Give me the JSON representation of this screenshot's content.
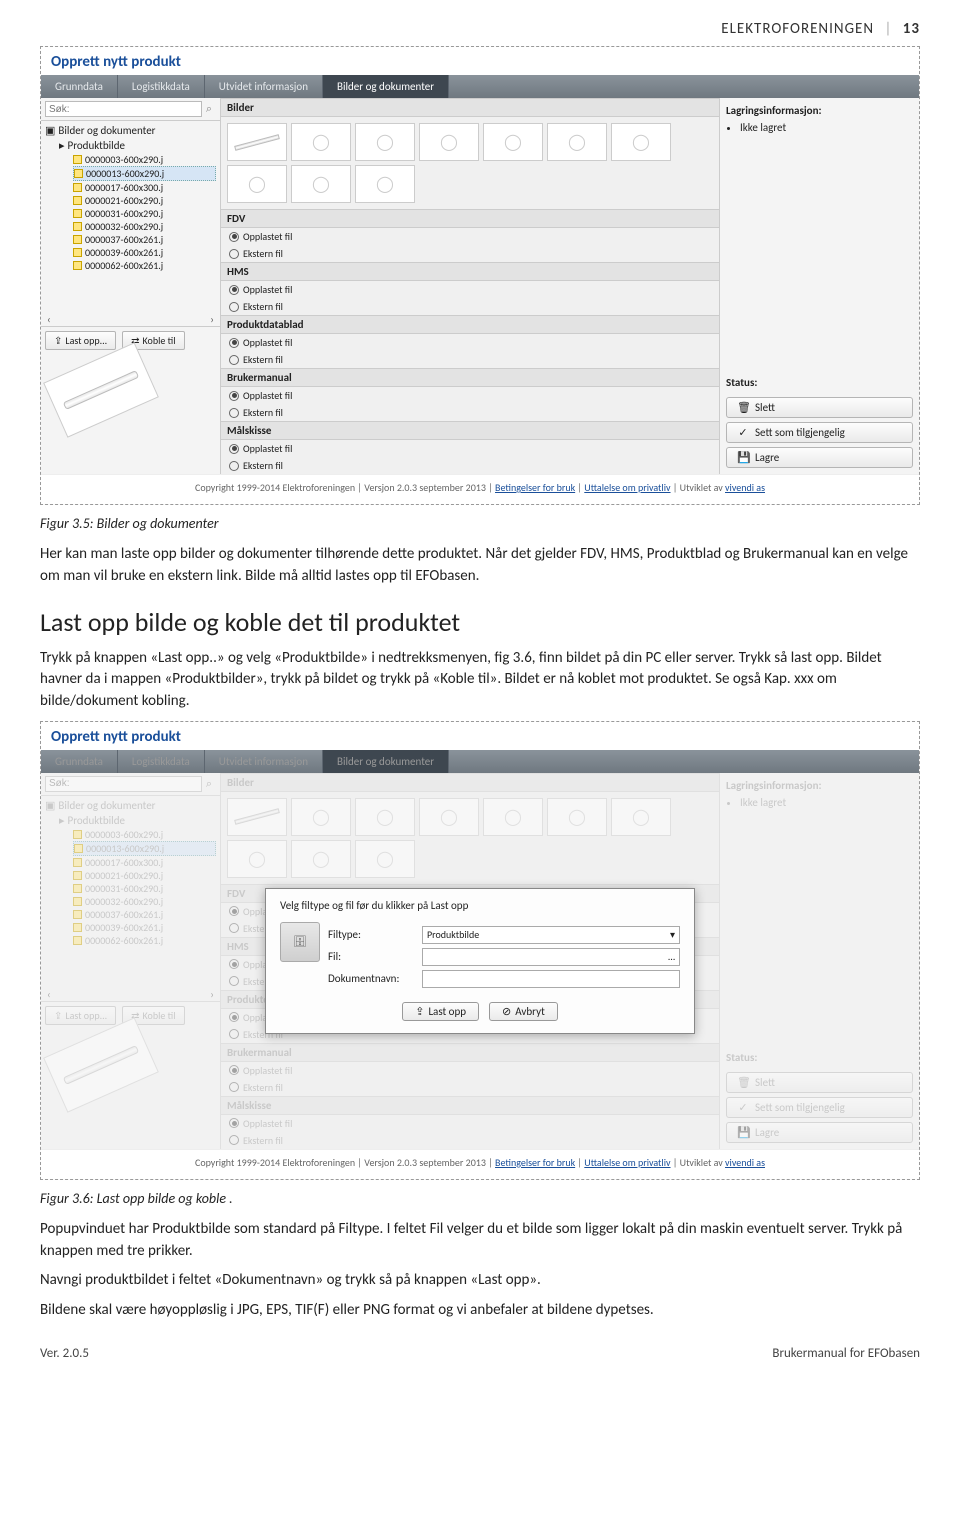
{
  "header": {
    "title": "ELEKTROFORENINGEN",
    "page": "13"
  },
  "app": {
    "title": "Opprett nytt produkt",
    "tabs": [
      "Grunndata",
      "Logistikkdata",
      "Utvidet informasjon",
      "Bilder og dokumenter"
    ],
    "search_placeholder": "Søk:",
    "tree_root": "Bilder og dokumenter",
    "tree_folder": "Produktbilde",
    "files": [
      "0000003-600x290.j",
      "0000013-600x290.j",
      "0000017-600x300.j",
      "0000021-600x290.j",
      "0000031-600x290.j",
      "0000032-600x290.j",
      "0000037-600x261.j",
      "0000039-600x261.j",
      "0000062-600x261.j"
    ],
    "btn_upload": "Last opp...",
    "btn_link": "Koble til",
    "sections": {
      "bilder": "Bilder",
      "fdv": "FDV",
      "hms": "HMS",
      "datablad": "Produktdatablad",
      "manual": "Brukermanual",
      "maalskisse": "Målskisse"
    },
    "radio_uploaded": "Opplastet fil",
    "radio_external": "Ekstern fil",
    "right": {
      "storage_label": "Lagringsinformasjon:",
      "storage_item": "Ikke lagret",
      "status_label": "Status:",
      "btn_delete": "Slett",
      "btn_avail": "Sett som tilgjengelig",
      "btn_save": "Lagre"
    },
    "copyright": {
      "text1": "Copyright 1999-2014 Elektroforeningen | Versjon 2.0.3 september 2013 | ",
      "link1": "Betingelser for bruk",
      "sep": " | ",
      "link2": "Uttalelse om privatliv",
      "text2": " | Utviklet av ",
      "link3": "vivendi as"
    }
  },
  "dialog": {
    "title": "Velg filtype og fil før du klikker på Last opp",
    "lbl_filtype": "Filtype:",
    "val_filtype": "Produktbilde",
    "lbl_fil": "Fil:",
    "lbl_doknavn": "Dokumentnavn:",
    "btn_upload": "Last opp",
    "btn_cancel": "Avbryt"
  },
  "captions": {
    "fig35": "Figur 3.5: Bilder og dokumenter",
    "fig36": "Figur 3.6: Last opp bilde og koble ."
  },
  "text": {
    "p1": "Her kan man laste opp bilder og dokumenter tilhørende dette produktet. Når det gjelder FDV, HMS, Produktblad og Brukermanual kan en velge om man vil bruke en ekstern link. Bilde må alltid lastes opp til EFObasen.",
    "h2": "Last opp bilde og koble det til produktet",
    "p2": "Trykk på knappen «Last opp..» og velg «Produktbilde» i nedtrekksmenyen, fig 3.6, finn bildet på din PC eller server. Trykk så last opp. Bildet havner da i mappen «Produktbilder», trykk på bildet og trykk på «Koble til». Bildet er nå koblet mot produktet.  Se også Kap. xxx om bilde/dokument kobling.",
    "p3": "Popupvinduet har Produktbilde som standard på Filtype. I feltet Fil velger du et bilde som ligger lokalt på din maskin eventuelt server. Trykk på knappen med tre prikker.",
    "p4": "Navngi produktbildet i feltet «Dokumentnavn» og trykk så på knappen «Last opp».",
    "p5": "Bildene skal være høyoppløslig i JPG, EPS, TIF(F) eller PNG format og vi anbefaler at bildene dypetses."
  },
  "footer": {
    "left": "Ver. 2.0.5",
    "right": "Brukermanual for EFObasen"
  }
}
